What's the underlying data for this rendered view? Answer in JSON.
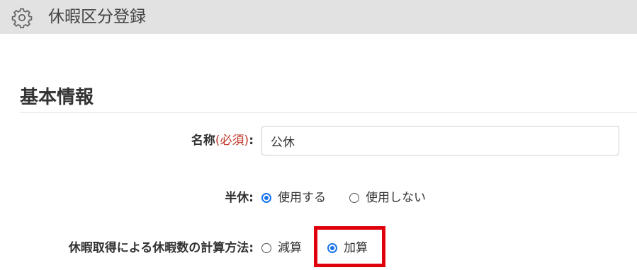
{
  "header": {
    "title": "休暇区分登録",
    "icon": "gear-icon",
    "background": "#e2e2e2"
  },
  "section": {
    "title": "基本情報"
  },
  "form": {
    "name": {
      "label": "名称",
      "required": "(必須)",
      "colon": ":",
      "value": "公休"
    },
    "half_day": {
      "label": "半休:",
      "options": [
        {
          "label": "使用する",
          "checked": true
        },
        {
          "label": "使用しない",
          "checked": false
        }
      ]
    },
    "calc_method": {
      "label": "休暇取得による休暇数の計算方法:",
      "options": [
        {
          "label": "減算",
          "checked": false
        },
        {
          "label": "加算",
          "checked": true
        }
      ]
    }
  },
  "colors": {
    "accent": "#1a73e8",
    "required": "#c0392b",
    "highlight": "#e0000b"
  }
}
